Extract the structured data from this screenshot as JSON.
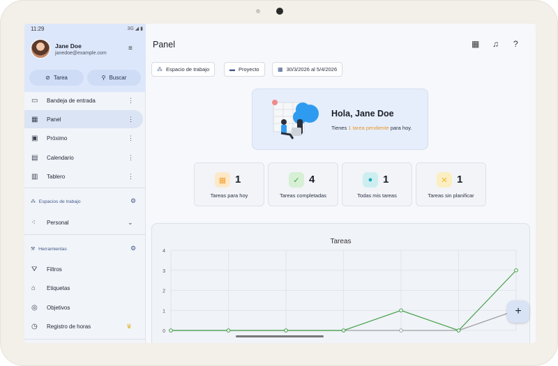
{
  "status": {
    "time": "11:29",
    "network": "3G"
  },
  "user": {
    "name": "Jane Doe",
    "email": "janedoe@example.com"
  },
  "actions": {
    "task": "Tarea",
    "search": "Buscar"
  },
  "nav": [
    {
      "label": "Bandeja de entrada",
      "icon": "inbox-icon",
      "glyph": "▭"
    },
    {
      "label": "Panel",
      "icon": "dashboard-icon",
      "glyph": "▦"
    },
    {
      "label": "Próximo",
      "icon": "calendar-upcoming-icon",
      "glyph": "▣"
    },
    {
      "label": "Calendario",
      "icon": "calendar-icon",
      "glyph": "▤"
    },
    {
      "label": "Tablero",
      "icon": "board-icon",
      "glyph": "▥"
    }
  ],
  "workspaces": {
    "header": "Espacios de trabajo",
    "current": "Personal"
  },
  "tools": {
    "header": "Herramientas",
    "items": [
      {
        "label": "Filtros",
        "icon": "filter-icon",
        "glyph": "⛛"
      },
      {
        "label": "Etiquetas",
        "icon": "tag-icon",
        "glyph": "⌂"
      },
      {
        "label": "Objetivos",
        "icon": "target-icon",
        "glyph": "◎"
      },
      {
        "label": "Registro de horas",
        "icon": "clock-icon",
        "glyph": "◷"
      }
    ]
  },
  "page": {
    "title": "Panel"
  },
  "filters": {
    "workspace": "Espacio de trabajo",
    "project": "Proyecto",
    "range": "30/3/2026 al 5/4/2026"
  },
  "greeting": {
    "title": "Hola, Jane Doe",
    "prefix": "Tienes",
    "highlight": "1 tarea pendiente",
    "suffix": "para hoy."
  },
  "stats": [
    {
      "value": "1",
      "label": "Tareas para hoy",
      "color": "#f2a33a",
      "bg": "#fde9c9",
      "icon": "calendar-today-icon"
    },
    {
      "value": "4",
      "label": "Tareas completadas",
      "color": "#43a047",
      "bg": "#d6efd5",
      "icon": "calendar-check-icon"
    },
    {
      "value": "1",
      "label": "Todas mis tareas",
      "color": "#1fa7b8",
      "bg": "#cdeef1",
      "icon": "person-icon"
    },
    {
      "value": "1",
      "label": "Tareas sin planificar",
      "color": "#f1b72f",
      "bg": "#fbeec2",
      "icon": "calendar-cross-icon"
    }
  ],
  "chart_data": {
    "type": "line",
    "title": "Tareas",
    "ylim": [
      0,
      4
    ],
    "yticks": [
      "0",
      "1",
      "2",
      "3",
      "4"
    ],
    "grid": true,
    "series": [
      {
        "color": "#43a047",
        "values": [
          0,
          0,
          0,
          0,
          1,
          0,
          3
        ]
      },
      {
        "color": "#9e9e9e",
        "values": [
          0,
          0,
          0,
          0,
          0,
          0,
          1
        ]
      }
    ]
  }
}
